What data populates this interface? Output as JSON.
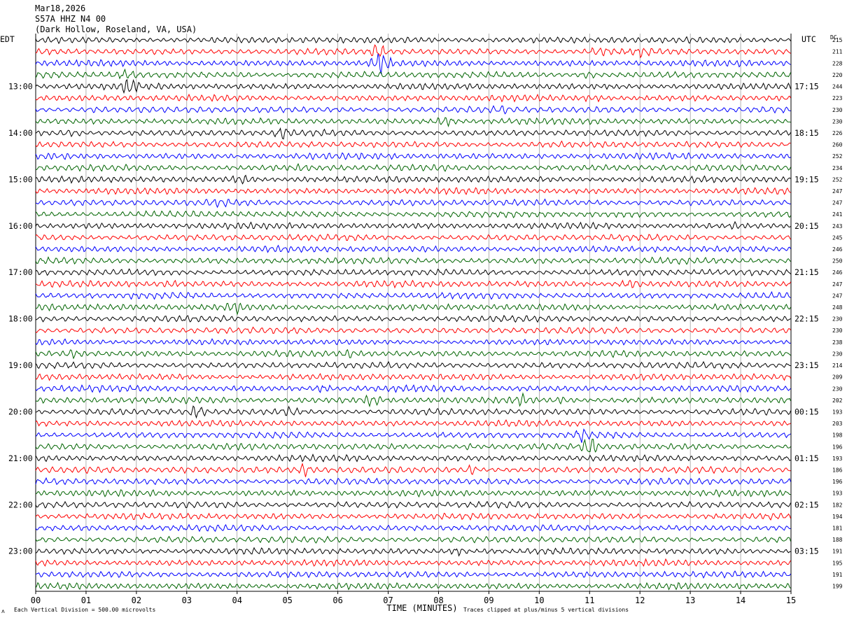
{
  "header": {
    "date": "Mar18,2026",
    "station": "S57A HHZ N4 00",
    "location": "(Dark Hollow, Roseland, VA, USA)"
  },
  "left_zone_label": "EDT",
  "right_zone_label": "UTC",
  "dc_label": "DC",
  "footer": {
    "scale_note": "Each Vertical Division =  500.00 microvolts",
    "clip_note": "Traces clipped at plus/minus 5 vertical divisions",
    "logo_mark": "ʌ"
  },
  "colors": {
    "cycle": [
      "#000000",
      "#ff0000",
      "#0000ff",
      "#006400"
    ],
    "grid": "#808080"
  },
  "chart_data": {
    "type": "line",
    "title": "Mar18,2026 S57A HHZ N4 00 (Dark Hollow, Roseland, VA, USA)",
    "xlabel": "TIME (MINUTES)",
    "ylabel": "",
    "xlim": [
      0,
      15
    ],
    "x_ticks": [
      "00",
      "01",
      "02",
      "03",
      "04",
      "05",
      "06",
      "07",
      "08",
      "09",
      "10",
      "11",
      "12",
      "13",
      "14",
      "15"
    ],
    "row_count": 48,
    "row_minutes": 15,
    "left_hour_labels": [
      {
        "row": 4,
        "label": "13:00"
      },
      {
        "row": 8,
        "label": "14:00"
      },
      {
        "row": 12,
        "label": "15:00"
      },
      {
        "row": 16,
        "label": "16:00"
      },
      {
        "row": 20,
        "label": "17:00"
      },
      {
        "row": 24,
        "label": "18:00"
      },
      {
        "row": 28,
        "label": "19:00"
      },
      {
        "row": 32,
        "label": "20:00"
      },
      {
        "row": 36,
        "label": "21:00"
      },
      {
        "row": 40,
        "label": "22:00"
      },
      {
        "row": 44,
        "label": "23:00"
      }
    ],
    "right_hour_labels": [
      {
        "row": 4,
        "label": "17:15"
      },
      {
        "row": 8,
        "label": "18:15"
      },
      {
        "row": 12,
        "label": "19:15"
      },
      {
        "row": 16,
        "label": "20:15"
      },
      {
        "row": 20,
        "label": "21:15"
      },
      {
        "row": 24,
        "label": "22:15"
      },
      {
        "row": 28,
        "label": "23:15"
      },
      {
        "row": 32,
        "label": "00:15"
      },
      {
        "row": 36,
        "label": "01:15"
      },
      {
        "row": 40,
        "label": "02:15"
      },
      {
        "row": 44,
        "label": "03:15"
      }
    ],
    "dc_offsets": [
      215,
      211,
      228,
      220,
      244,
      223,
      230,
      230,
      226,
      260,
      252,
      234,
      252,
      247,
      247,
      241,
      243,
      245,
      246,
      250,
      246,
      247,
      247,
      248,
      230,
      230,
      238,
      230,
      214,
      209,
      230,
      202,
      193,
      203,
      198,
      196,
      193,
      186,
      196,
      193,
      182,
      194,
      181,
      188,
      191,
      195,
      191,
      199
    ],
    "bursts": [
      {
        "row": 1,
        "start": 6.7,
        "end": 6.9,
        "amp": 2.5
      },
      {
        "row": 1,
        "start": 11.0,
        "end": 11.4,
        "amp": 1.5
      },
      {
        "row": 1,
        "start": 11.9,
        "end": 12.2,
        "amp": 1.5
      },
      {
        "row": 2,
        "start": 6.7,
        "end": 7.0,
        "amp": 2.8
      },
      {
        "row": 3,
        "start": 1.6,
        "end": 2.0,
        "amp": 1.6
      },
      {
        "row": 3,
        "start": 4.0,
        "end": 4.3,
        "amp": 1.4
      },
      {
        "row": 3,
        "start": 10.8,
        "end": 11.2,
        "amp": 1.6
      },
      {
        "row": 4,
        "start": 1.7,
        "end": 2.0,
        "amp": 2.2
      },
      {
        "row": 5,
        "start": 10.8,
        "end": 11.3,
        "amp": 1.5
      },
      {
        "row": 6,
        "start": 1.0,
        "end": 1.4,
        "amp": 1.3
      },
      {
        "row": 6,
        "start": 9.0,
        "end": 9.4,
        "amp": 1.4
      },
      {
        "row": 7,
        "start": 8.0,
        "end": 8.3,
        "amp": 2.0
      },
      {
        "row": 8,
        "start": 0.4,
        "end": 1.0,
        "amp": 1.4
      },
      {
        "row": 8,
        "start": 4.8,
        "end": 5.0,
        "amp": 2.0
      },
      {
        "row": 11,
        "start": 5.1,
        "end": 5.4,
        "amp": 1.3
      },
      {
        "row": 12,
        "start": 3.8,
        "end": 4.4,
        "amp": 1.6
      },
      {
        "row": 12,
        "start": 5.1,
        "end": 5.5,
        "amp": 1.4
      },
      {
        "row": 14,
        "start": 3.4,
        "end": 3.8,
        "amp": 1.4
      },
      {
        "row": 16,
        "start": 13.8,
        "end": 14.0,
        "amp": 1.3
      },
      {
        "row": 21,
        "start": 11.6,
        "end": 12.0,
        "amp": 2.0
      },
      {
        "row": 21,
        "start": 2.5,
        "end": 2.9,
        "amp": 1.4
      },
      {
        "row": 23,
        "start": 0.0,
        "end": 0.5,
        "amp": 1.6
      },
      {
        "row": 23,
        "start": 3.8,
        "end": 4.1,
        "amp": 2.0
      },
      {
        "row": 26,
        "start": 0.0,
        "end": 15.0,
        "amp": 0.9
      },
      {
        "row": 27,
        "start": 0.6,
        "end": 0.9,
        "amp": 2.0
      },
      {
        "row": 27,
        "start": 6.1,
        "end": 6.3,
        "amp": 1.6
      },
      {
        "row": 30,
        "start": 5.5,
        "end": 5.9,
        "amp": 1.6
      },
      {
        "row": 31,
        "start": 6.6,
        "end": 6.8,
        "amp": 2.4
      },
      {
        "row": 31,
        "start": 9.5,
        "end": 9.8,
        "amp": 1.8
      },
      {
        "row": 31,
        "start": 10.3,
        "end": 10.6,
        "amp": 1.6
      },
      {
        "row": 32,
        "start": 3.1,
        "end": 3.3,
        "amp": 2.2
      },
      {
        "row": 32,
        "start": 4.9,
        "end": 5.2,
        "amp": 1.8
      },
      {
        "row": 34,
        "start": 10.8,
        "end": 10.9,
        "amp": 2.0
      },
      {
        "row": 35,
        "start": 8.5,
        "end": 8.7,
        "amp": 1.6
      },
      {
        "row": 35,
        "start": 10.9,
        "end": 11.1,
        "amp": 3.0
      },
      {
        "row": 37,
        "start": 2.4,
        "end": 3.6,
        "amp": 1.5
      },
      {
        "row": 37,
        "start": 5.3,
        "end": 5.4,
        "amp": 2.2
      },
      {
        "row": 37,
        "start": 8.6,
        "end": 8.7,
        "amp": 2.2
      },
      {
        "row": 44,
        "start": 8.3,
        "end": 8.5,
        "amp": 1.8
      },
      {
        "row": 44,
        "start": 8.8,
        "end": 9.2,
        "amp": 1.2
      }
    ]
  }
}
